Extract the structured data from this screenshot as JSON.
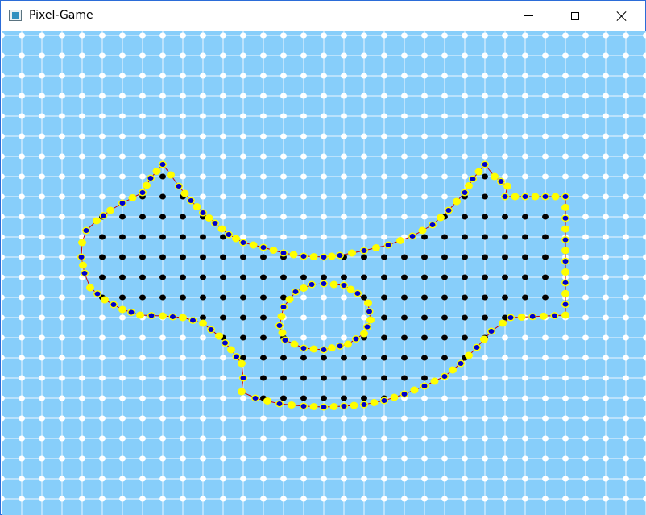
{
  "window": {
    "title": "Pixel-Game",
    "icon": "app-window-icon",
    "controls": [
      "minimize-icon",
      "maximize-icon",
      "close-icon"
    ]
  },
  "colors": {
    "background": "#87cefa",
    "grid_dot": "#ffffff",
    "outline_line": "#cc0000",
    "outline_ring": "#ffff00",
    "outline_marker": "#0000cc",
    "interior_marker": "#000000"
  }
}
